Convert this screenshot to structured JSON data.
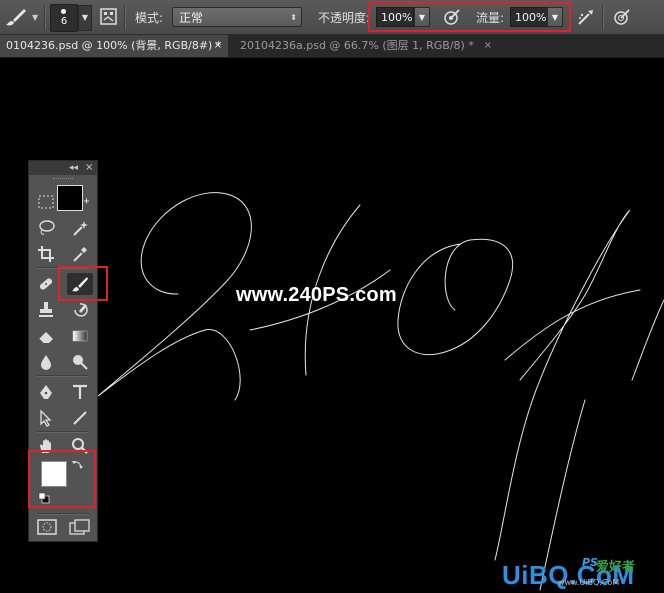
{
  "options_bar": {
    "brush_size": "6",
    "mode_label": "模式:",
    "mode_value": "正常",
    "opacity_label": "不透明度:",
    "opacity_value": "100%",
    "flow_label": "流量:",
    "flow_value": "100%"
  },
  "tabs": [
    {
      "label": "0104236.psd @ 100% (背景, RGB/8#) *",
      "close": "×"
    },
    {
      "label": "20104236a.psd @ 66.7% (图层 1, RGB/8) *",
      "close": "×"
    }
  ],
  "canvas": {
    "watermark": "www.240PS.com"
  },
  "tools_panel": {
    "collapse_glyph": "◂◂",
    "close_glyph": "×",
    "foreground_color": "#ffffff",
    "background_color": "#000000"
  },
  "site_logo": {
    "brand": "UiBQ.CoM",
    "ps_mark": "PS",
    "cn_mark": "爱好者",
    "sub": "www.UiBQ.CoM"
  },
  "colors": {
    "highlight": "#e0202a",
    "panel": "#535353",
    "optbar": "#4f4f4f"
  }
}
